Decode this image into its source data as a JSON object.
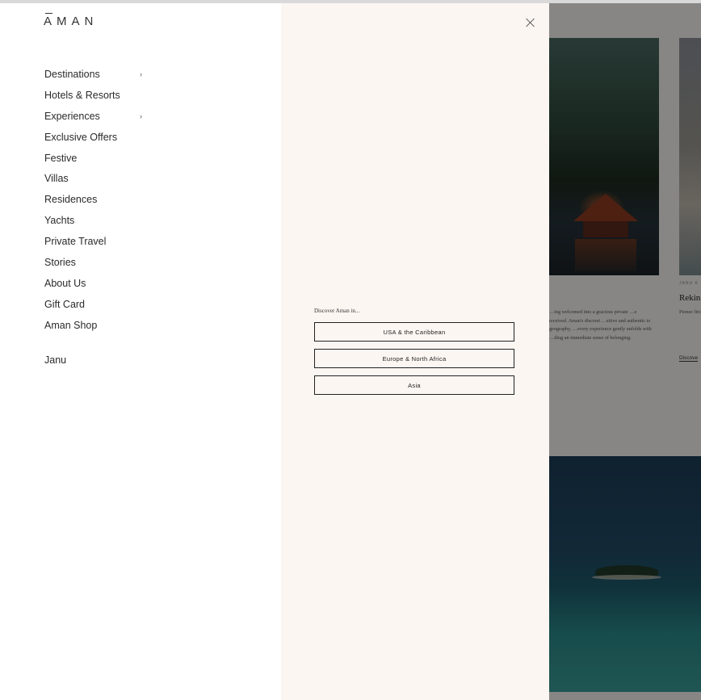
{
  "brand": {
    "logo": "AMAN"
  },
  "nav": {
    "items": [
      {
        "label": "Destinations",
        "chevron": "›"
      },
      {
        "label": "Hotels & Resorts"
      },
      {
        "label": "Experiences",
        "chevron": "›"
      },
      {
        "label": "Exclusive Offers"
      },
      {
        "label": "Festive"
      },
      {
        "label": "Villas"
      },
      {
        "label": "Residences"
      },
      {
        "label": "Yachts"
      },
      {
        "label": "Private Travel"
      },
      {
        "label": "Stories"
      },
      {
        "label": "About Us"
      },
      {
        "label": "Gift Card"
      },
      {
        "label": "Aman Shop"
      }
    ],
    "secondary": "Janu"
  },
  "discover": {
    "heading": "Discover Aman in...",
    "regions": [
      "USA & the Caribbean",
      "Europe & North Africa",
      "Asia"
    ]
  },
  "background": {
    "label": "JANU K",
    "heading": "Rekin",
    "body": "…ing welcomed into a gracious private …e received. Aman's discreet …sitive and authentic to geography, …every experience gently unfolds with …ding an immediate sense of belonging.",
    "body2": "Pionee first bo of Azab of the c experie",
    "link": "Discove"
  },
  "colors": {
    "mid_panel_bg": "#fcf6f2",
    "nav_bg": "#ffffff"
  },
  "icons": {
    "close": "close-icon",
    "chevron": "chevron-right-icon"
  }
}
